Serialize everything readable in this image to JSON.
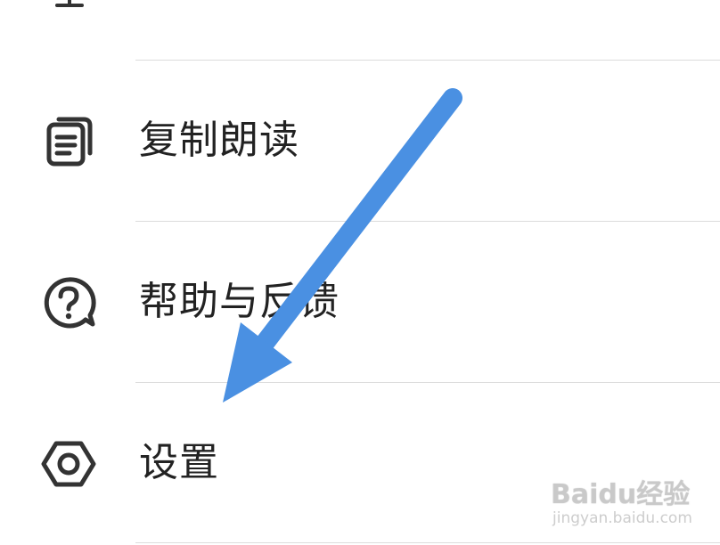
{
  "menu": {
    "items": [
      {
        "id": "copy-read",
        "label": "复制朗读",
        "icon": "document-copy-icon"
      },
      {
        "id": "help-feedback",
        "label": "帮助与反馈",
        "icon": "help-chat-icon"
      },
      {
        "id": "settings",
        "label": "设置",
        "icon": "hexagon-settings-icon"
      }
    ]
  },
  "overlay": {
    "arrow_color": "#4a90e2"
  },
  "watermark": {
    "brand": "Baidu经验",
    "url": "jingyan.baidu.com"
  },
  "colors": {
    "text": "#222222",
    "divider": "#dcdcdc",
    "icon": "#333333"
  }
}
